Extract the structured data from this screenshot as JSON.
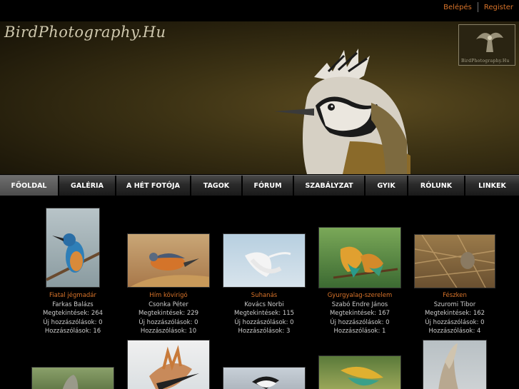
{
  "topbar": {
    "login": "Belépés",
    "register": "Register"
  },
  "site": {
    "title": "BirdPhotography.Hu",
    "stamp": "BirdPhotography.Hu"
  },
  "nav": [
    {
      "label": "FŐOLDAL"
    },
    {
      "label": "GALÉRIA"
    },
    {
      "label": "A HÉT FOTÓJA"
    },
    {
      "label": "TAGOK"
    },
    {
      "label": "FÓRUM"
    },
    {
      "label": "SZABÁLYZAT"
    },
    {
      "label": "GYIK"
    },
    {
      "label": "RÓLUNK"
    },
    {
      "label": "LINKEK"
    }
  ],
  "photos": [
    {
      "title": "Fiatal jégmadár",
      "author": "Farkas Balázs",
      "views": "Megtekintések: 264",
      "new_comments": "Új hozzászólások: 0",
      "comments": "Hozzászólások: 16"
    },
    {
      "title": "Hím kövirigó",
      "author": "Csonka Péter",
      "views": "Megtekintések: 229",
      "new_comments": "Új hozzászólások: 0",
      "comments": "Hozzászólások: 10"
    },
    {
      "title": "Suhanás",
      "author": "Kovács Norbi",
      "views": "Megtekintések: 115",
      "new_comments": "Új hozzászólások: 0",
      "comments": "Hozzászólások: 3"
    },
    {
      "title": "Gyurgyalag-szerelem",
      "author": "Szabó Endre János",
      "views": "Megtekintések: 167",
      "new_comments": "Új hozzászólások: 0",
      "comments": "Hozzászólások: 1"
    },
    {
      "title": "Fészken",
      "author": "Szuromi Tibor",
      "views": "Megtekintések: 162",
      "new_comments": "Új hozzászólások: 0",
      "comments": "Hozzászólások: 4"
    }
  ],
  "colors": {
    "accent": "#d9742a",
    "background": "#000000",
    "nav": "#2a2a2a"
  }
}
